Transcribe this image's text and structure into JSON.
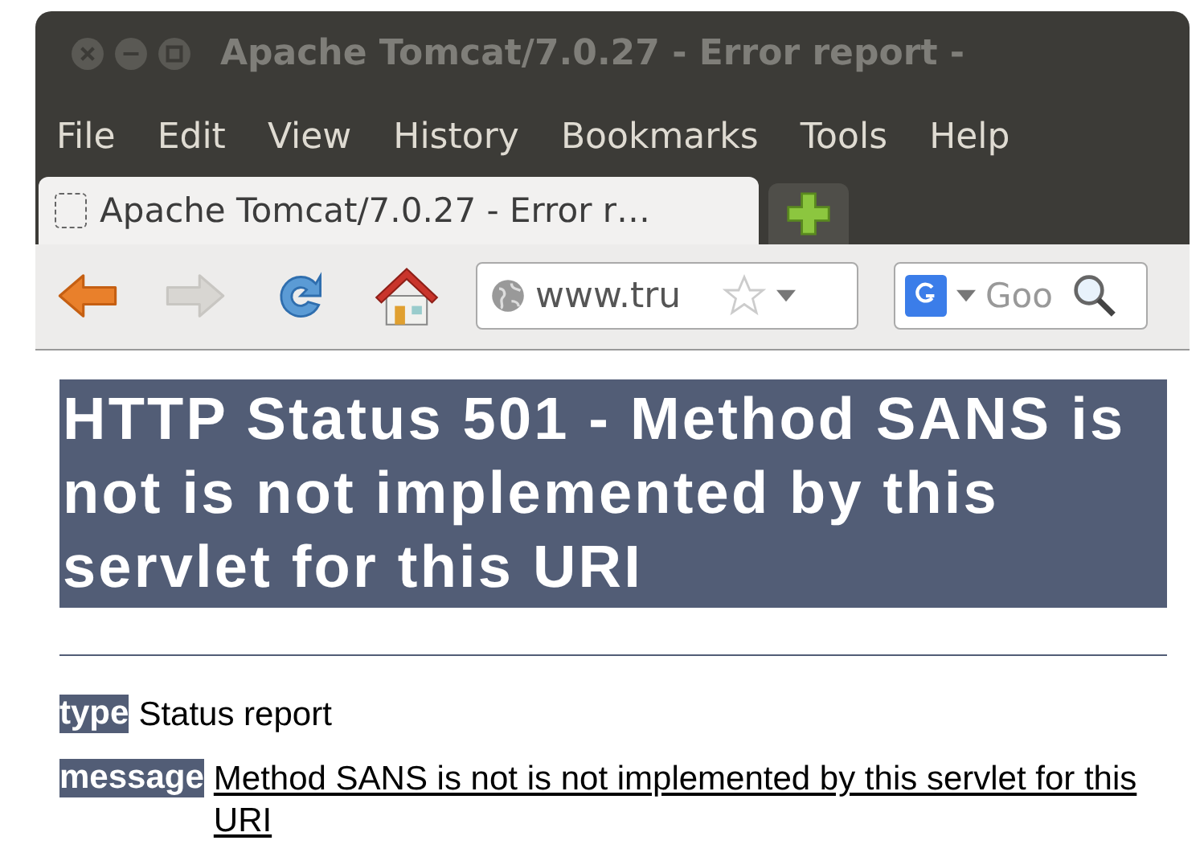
{
  "window": {
    "title": "Apache Tomcat/7.0.27 - Error report -"
  },
  "menu": [
    {
      "label": "File"
    },
    {
      "label": "Edit"
    },
    {
      "label": "View"
    },
    {
      "label": "History"
    },
    {
      "label": "Bookmarks"
    },
    {
      "label": "Tools"
    },
    {
      "label": "Help"
    }
  ],
  "tabs": [
    {
      "label": "Apache Tomcat/7.0.27 - Error r…",
      "selected": true
    }
  ],
  "toolbar": {
    "forward_disabled": true,
    "address": {
      "value": "www.tru"
    },
    "search": {
      "placeholder": "Goo"
    }
  },
  "page": {
    "heading": "HTTP Status 501 - Method SANS is not is not implemented by this servlet for this URI",
    "fields": [
      {
        "label": "type",
        "value": "Status report",
        "underlined": false
      },
      {
        "label": "message",
        "value": "Method SANS is not is not implemented by this servlet for this URI",
        "underlined": true
      }
    ]
  }
}
